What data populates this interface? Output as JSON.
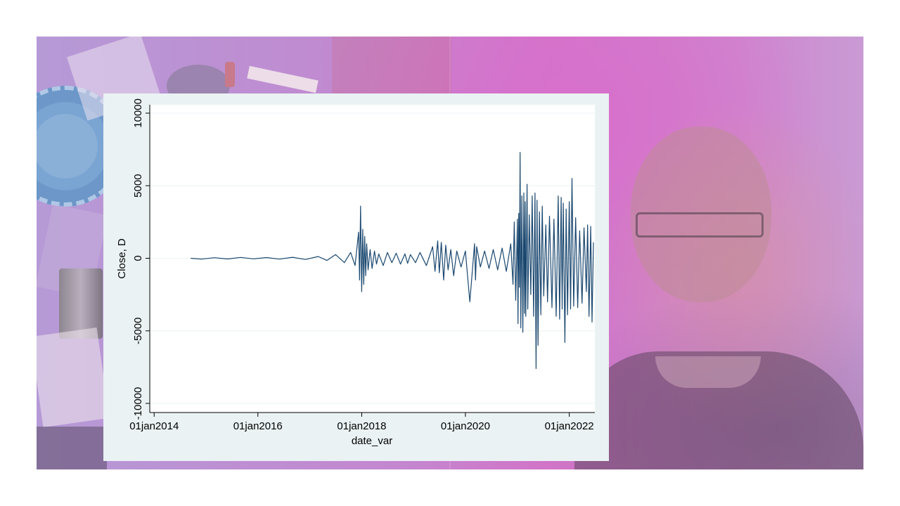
{
  "background": {
    "slide_color": "#c98ad1",
    "panel_color": "#eaf2f3",
    "plot_color": "#ffffff"
  },
  "chart_data": {
    "type": "line",
    "title": "",
    "xlabel": "date_var",
    "ylabel": "Close, D",
    "xlim": [
      "2013-12-01",
      "2022-06-30"
    ],
    "ylim": [
      -10000,
      10000
    ],
    "x_ticks": [
      "01jan2014",
      "01jan2016",
      "01jan2018",
      "01jan2020",
      "01jan2022"
    ],
    "y_ticks": [
      "-10000",
      "-5000",
      "0",
      "5000",
      "10000"
    ],
    "grid": true,
    "line_color": "#1a476f",
    "series": [
      {
        "x": [
          "2014-09-15",
          "2014-12-01",
          "2015-03-01",
          "2015-06-01",
          "2015-09-01",
          "2015-12-01",
          "2016-03-01",
          "2016-06-01",
          "2016-09-01",
          "2016-12-01",
          "2017-03-01",
          "2017-05-01",
          "2017-07-01",
          "2017-09-01",
          "2017-10-15",
          "2017-11-15",
          "2017-12-10",
          "2017-12-17",
          "2017-12-24",
          "2018-01-01",
          "2018-01-08",
          "2018-01-15",
          "2018-01-22",
          "2018-01-29",
          "2018-02-05",
          "2018-02-15",
          "2018-03-01",
          "2018-03-15",
          "2018-04-01",
          "2018-04-15",
          "2018-05-01",
          "2018-06-01",
          "2018-07-01",
          "2018-08-01",
          "2018-09-01",
          "2018-10-01",
          "2018-11-01",
          "2018-11-20",
          "2018-12-10",
          "2019-01-15",
          "2019-02-15",
          "2019-04-01",
          "2019-05-15",
          "2019-06-01",
          "2019-06-20",
          "2019-07-01",
          "2019-07-15",
          "2019-08-01",
          "2019-08-15",
          "2019-09-01",
          "2019-09-20",
          "2019-10-10",
          "2019-11-01",
          "2019-12-01",
          "2020-01-01",
          "2020-02-01",
          "2020-03-05",
          "2020-03-12",
          "2020-03-20",
          "2020-04-15",
          "2020-05-15",
          "2020-06-15",
          "2020-07-15",
          "2020-08-15",
          "2020-09-15",
          "2020-10-15",
          "2020-11-15",
          "2020-12-01",
          "2020-12-10",
          "2020-12-20",
          "2021-01-01",
          "2021-01-05",
          "2021-01-10",
          "2021-01-15",
          "2021-01-20",
          "2021-01-25",
          "2021-02-01",
          "2021-02-08",
          "2021-02-15",
          "2021-02-20",
          "2021-02-25",
          "2021-03-01",
          "2021-03-10",
          "2021-03-15",
          "2021-03-25",
          "2021-04-05",
          "2021-04-15",
          "2021-04-25",
          "2021-05-05",
          "2021-05-12",
          "2021-05-19",
          "2021-05-26",
          "2021-06-05",
          "2021-06-15",
          "2021-06-25",
          "2021-07-05",
          "2021-07-20",
          "2021-08-01",
          "2021-08-15",
          "2021-09-01",
          "2021-09-15",
          "2021-10-01",
          "2021-10-15",
          "2021-10-25",
          "2021-11-05",
          "2021-11-12",
          "2021-11-20",
          "2021-12-01",
          "2021-12-10",
          "2021-12-20",
          "2022-01-01",
          "2022-01-10",
          "2022-01-20",
          "2022-02-01",
          "2022-02-15",
          "2022-03-01",
          "2022-03-15",
          "2022-04-01",
          "2022-04-15",
          "2022-05-01",
          "2022-05-10",
          "2022-05-20",
          "2022-06-01",
          "2022-06-10",
          "2022-06-20"
        ],
        "y": [
          0,
          -60,
          40,
          -50,
          60,
          -40,
          50,
          -60,
          70,
          -80,
          120,
          -150,
          250,
          -300,
          400,
          -500,
          1800,
          -1500,
          3600,
          -2300,
          2000,
          -1800,
          1500,
          -1200,
          1000,
          -800,
          600,
          -700,
          500,
          -400,
          300,
          -500,
          400,
          -300,
          350,
          -400,
          300,
          -350,
          250,
          -300,
          400,
          -500,
          800,
          -900,
          1200,
          -1000,
          1100,
          -1500,
          900,
          -800,
          600,
          -1200,
          500,
          -600,
          500,
          -3000,
          1000,
          -1500,
          800,
          -600,
          500,
          -700,
          600,
          -800,
          700,
          -900,
          1000,
          -1800,
          2500,
          -2900,
          2700,
          -4500,
          3100,
          -2000,
          7300,
          -4800,
          4300,
          -5100,
          4500,
          -3800,
          3900,
          -4000,
          5100,
          -3500,
          3000,
          -2500,
          4300,
          -4000,
          4500,
          -7600,
          4000,
          -6000,
          3200,
          -3900,
          3600,
          -2600,
          2300,
          -3000,
          2900,
          -3400,
          2700,
          -4000,
          4300,
          -4200,
          4200,
          -3500,
          3800,
          -5800,
          3400,
          -3900,
          3900,
          -3500,
          5500,
          -3300,
          2800,
          -3400,
          1900,
          -3100,
          2100,
          -2300,
          2300,
          -4000,
          2200,
          -4400,
          1100
        ]
      }
    ]
  }
}
